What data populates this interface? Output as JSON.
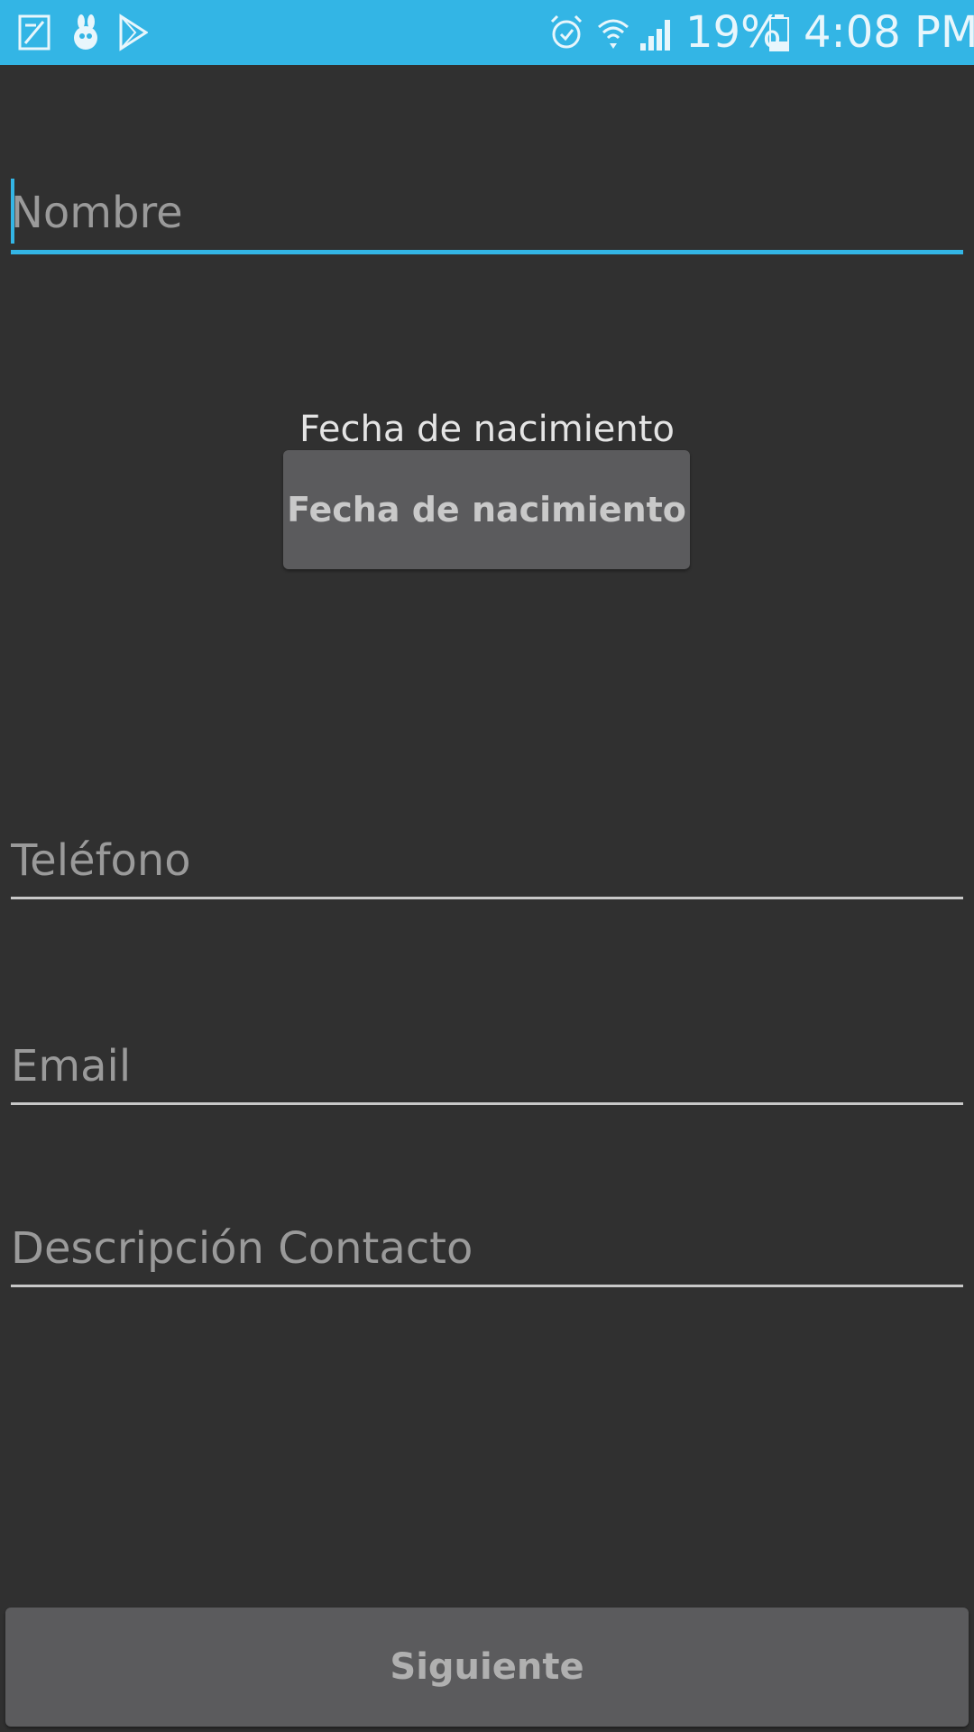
{
  "status_bar": {
    "left_icons": [
      "edit-note-icon",
      "bug-icon",
      "play-store-icon"
    ],
    "right_icons": [
      "alarm-icon",
      "wifi-icon",
      "signal-icon",
      "battery-icon"
    ],
    "battery": "19%",
    "time": "4:08 PM",
    "color": "#33b5e5"
  },
  "form": {
    "nombre": {
      "placeholder": "Nombre",
      "value": ""
    },
    "fecha_label": "Fecha de nacimiento",
    "fecha_button": "Fecha de nacimiento",
    "telefono": {
      "placeholder": "Teléfono",
      "value": ""
    },
    "email": {
      "placeholder": "Email",
      "value": ""
    },
    "descripcion": {
      "placeholder": "Descripción Contacto",
      "value": ""
    }
  },
  "next_button": "Siguiente",
  "colors": {
    "background": "#303030",
    "accent": "#33b5e5",
    "button": "#5b5b5d"
  }
}
